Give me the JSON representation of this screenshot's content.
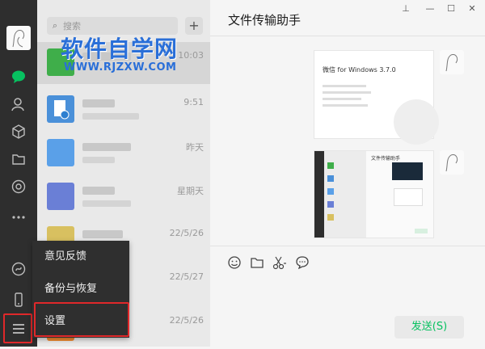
{
  "search": {
    "placeholder": "搜索",
    "add_symbol": "+"
  },
  "watermark": {
    "main": "软件自学网",
    "url": "WWW.RJZXW.COM"
  },
  "chats": [
    {
      "time": "10:03",
      "avatar_color": "#3fae4a"
    },
    {
      "time": "9:51",
      "avatar_color": "#4a90d9"
    },
    {
      "time": "昨天",
      "avatar_color": "#5aa0e8"
    },
    {
      "time": "星期天",
      "avatar_color": "#6a7fd6"
    },
    {
      "time": "22/5/26",
      "avatar_color": "#d8c060"
    },
    {
      "time": "22/5/27",
      "avatar_color": "#9aa0a8"
    },
    {
      "time": "22/5/26",
      "avatar_color": "#f08a30"
    }
  ],
  "menu": {
    "items": [
      "意见反馈",
      "备份与恢复",
      "设置"
    ]
  },
  "main": {
    "title": "文件传输助手",
    "send_label": "发送(S)"
  },
  "window_controls": {
    "pin": "⊥",
    "min": "—",
    "max": "☐",
    "close": "✕"
  },
  "screenshot1": {
    "title": "微信 for Windows 3.7.0"
  },
  "screenshot2": {
    "title": "文件传输助手"
  },
  "colors": {
    "accent": "#07c160",
    "highlight": "#e0282a",
    "watermark": "#2a6fd8"
  }
}
